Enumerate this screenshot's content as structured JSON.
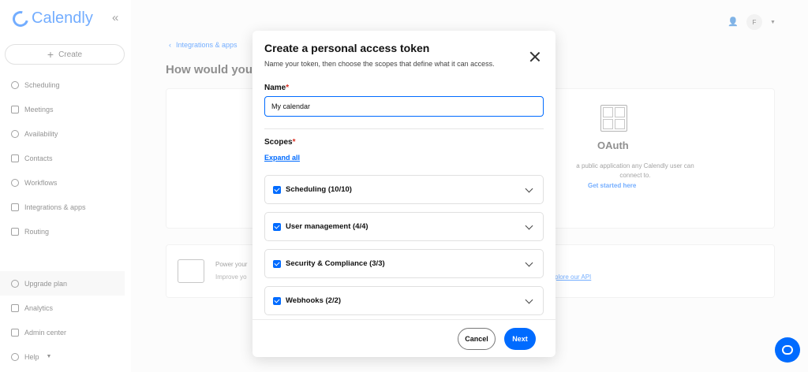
{
  "brand": {
    "name": "Calendly",
    "accent": "#006bff"
  },
  "sidebar": {
    "create_label": "Create",
    "items": [
      {
        "label": "Scheduling",
        "icon": "link-icon"
      },
      {
        "label": "Meetings",
        "icon": "calendar-icon"
      },
      {
        "label": "Availability",
        "icon": "clock-icon"
      },
      {
        "label": "Contacts",
        "icon": "contacts-icon"
      },
      {
        "label": "Workflows",
        "icon": "workflow-icon"
      },
      {
        "label": "Integrations & apps",
        "icon": "grid-icon"
      },
      {
        "label": "Routing",
        "icon": "routing-icon"
      }
    ],
    "bottom_items": [
      {
        "label": "Upgrade plan",
        "icon": "upgrade-icon"
      },
      {
        "label": "Analytics",
        "icon": "analytics-icon"
      },
      {
        "label": "Admin center",
        "icon": "admin-icon"
      },
      {
        "label": "Help",
        "icon": "help-icon"
      }
    ]
  },
  "header": {
    "avatar_initial": "F"
  },
  "background": {
    "breadcrumb": "Integrations & apps",
    "page_title": "How would you li",
    "oauth_title": "OAuth",
    "oauth_desc_line1": "a public application any Calendly user can",
    "oauth_desc_line2": "connect to.",
    "oauth_link": "Get started here",
    "power_title": "Power your",
    "power_desc": "Improve yo",
    "explore_link": "plore our API"
  },
  "modal": {
    "title": "Create a personal access token",
    "subtitle": "Name your token, then choose the scopes that define what it can access.",
    "name_label": "Name",
    "name_value": "My calendar",
    "scopes_label": "Scopes",
    "expand_all": "Expand all",
    "scopes": [
      {
        "label": "Scheduling (10/10)",
        "checked": true
      },
      {
        "label": "User management (4/4)",
        "checked": true
      },
      {
        "label": "Security & Compliance (3/3)",
        "checked": true
      },
      {
        "label": "Webhooks (2/2)",
        "checked": true
      }
    ],
    "cancel_label": "Cancel",
    "next_label": "Next"
  }
}
